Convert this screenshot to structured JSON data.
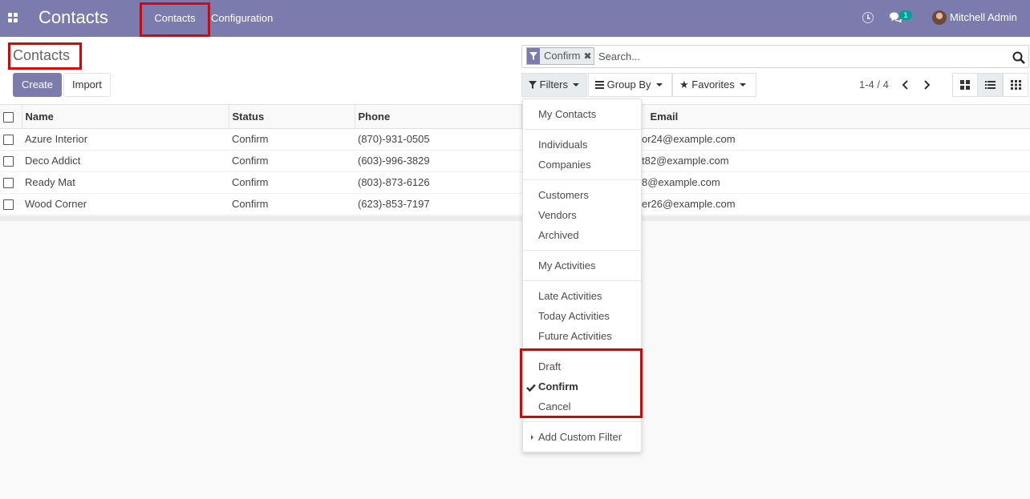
{
  "navbar": {
    "app_title": "Contacts",
    "menus": [
      "Contacts",
      "Configuration"
    ],
    "chat_count": "1",
    "user_name": "Mitchell Admin"
  },
  "control_panel": {
    "title": "Contacts",
    "create_label": "Create",
    "import_label": "Import",
    "search": {
      "facet_value": "Confirm",
      "placeholder": "Search..."
    },
    "filters_label": "Filters",
    "groupby_label": "Group By",
    "favorites_label": "Favorites",
    "pager": "1-4 / 4"
  },
  "table": {
    "columns": [
      "Name",
      "Status",
      "Phone",
      "Email"
    ],
    "rows": [
      {
        "name": "Azure Interior",
        "status": "Confirm",
        "phone": "(870)-931-0505",
        "email": "or24@example.com"
      },
      {
        "name": "Deco Addict",
        "status": "Confirm",
        "phone": "(603)-996-3829",
        "email": "t82@example.com"
      },
      {
        "name": "Ready Mat",
        "status": "Confirm",
        "phone": "(803)-873-6126",
        "email": "8@example.com"
      },
      {
        "name": "Wood Corner",
        "status": "Confirm",
        "phone": "(623)-853-7197",
        "email": "er26@example.com"
      }
    ]
  },
  "filters_menu": {
    "my_contacts": "My Contacts",
    "individuals": "Individuals",
    "companies": "Companies",
    "customers": "Customers",
    "vendors": "Vendors",
    "archived": "Archived",
    "my_activities": "My Activities",
    "late_activities": "Late Activities",
    "today_activities": "Today Activities",
    "future_activities": "Future Activities",
    "draft": "Draft",
    "confirm": "Confirm",
    "cancel": "Cancel",
    "add_custom_filter": "Add Custom Filter",
    "checked_item": "Confirm"
  },
  "colors": {
    "navbar": "#7c7bad",
    "annotation": "#e00000",
    "badge": "#00a09d"
  }
}
